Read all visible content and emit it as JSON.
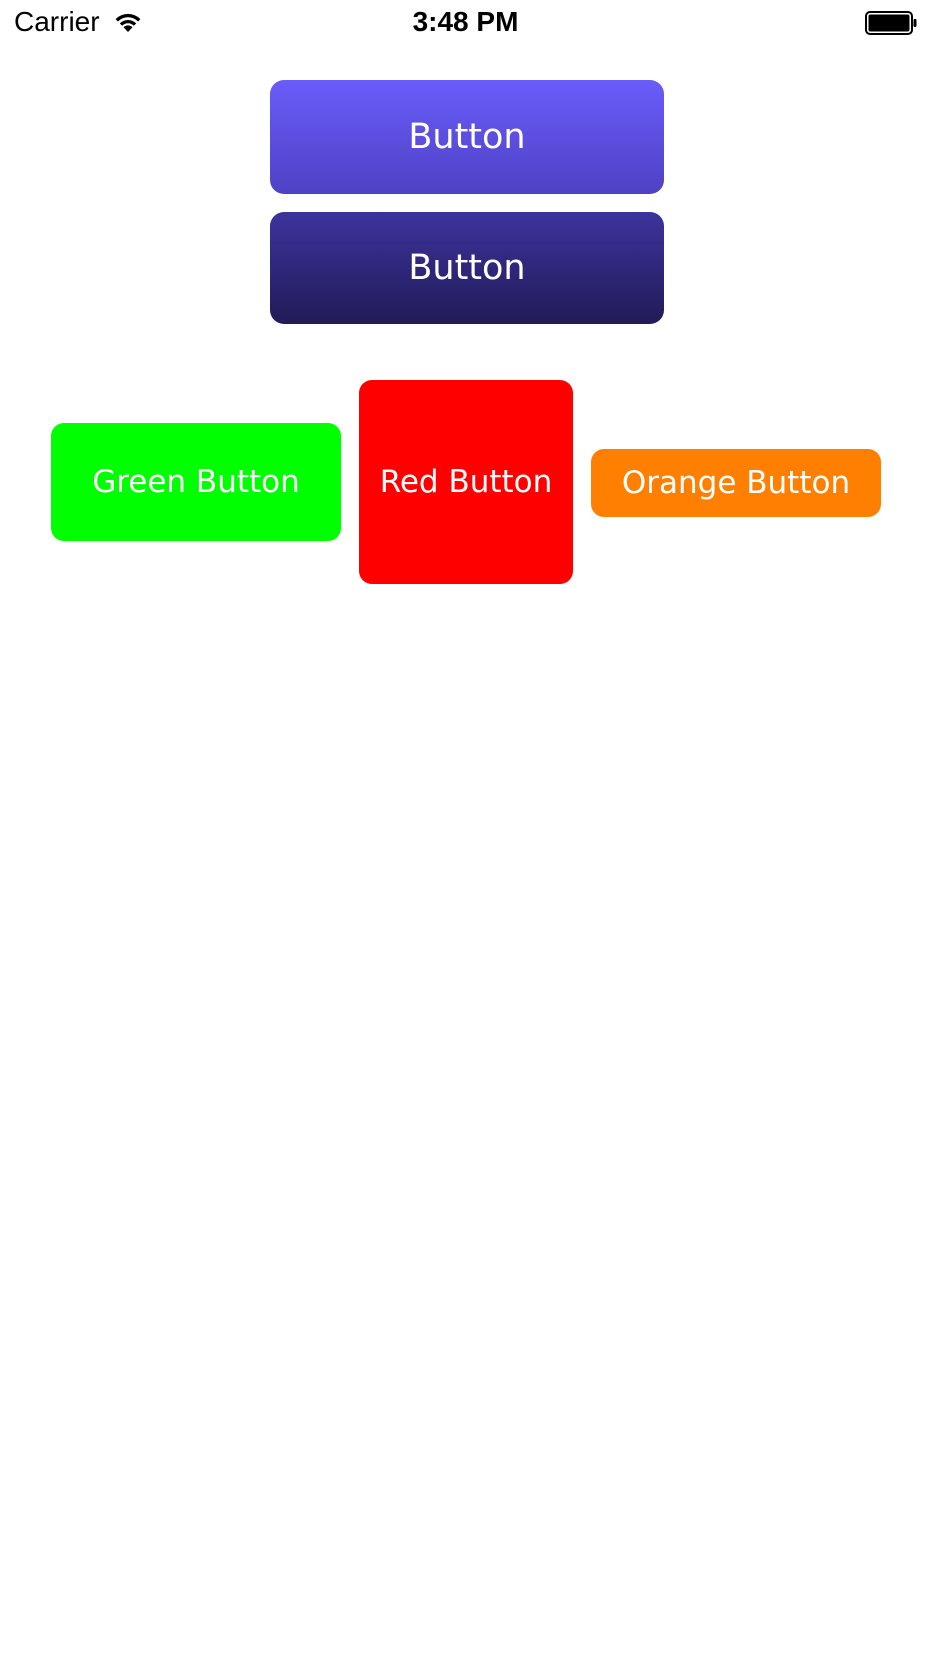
{
  "status_bar": {
    "carrier": "Carrier",
    "time": "3:48 PM",
    "wifi_icon": "wifi-icon",
    "battery_icon": "battery-icon"
  },
  "buttons": {
    "top_label": "Button",
    "second_label": "Button",
    "green_label": "Green Button",
    "red_label": "Red Button",
    "orange_label": "Orange Button"
  },
  "colors": {
    "top_gradient_start": "#6a5cfa",
    "top_gradient_end": "#4e42c4",
    "second_gradient_start": "#3d339e",
    "second_gradient_end": "#211b56",
    "green": "#00ff00",
    "red": "#ff0000",
    "orange": "#ff8000",
    "button_text": "#ffffff"
  }
}
